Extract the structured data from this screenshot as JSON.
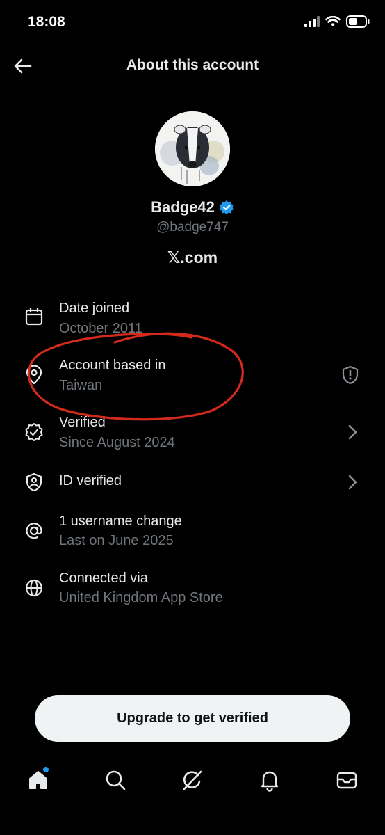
{
  "status_bar": {
    "time": "18:08"
  },
  "header": {
    "title": "About this account",
    "back_icon": "back-arrow-icon"
  },
  "profile": {
    "display_name": "Badge42",
    "handle": "@badge747",
    "platform": "𝕏.com",
    "verified_color": "#1d9bf0"
  },
  "info": [
    {
      "icon": "calendar-icon",
      "title": "Date joined",
      "subtitle": "October 2011"
    },
    {
      "icon": "location-pin-icon",
      "title": "Account based in",
      "subtitle": "Taiwan",
      "trailing_icon": "shield-alert-icon"
    },
    {
      "icon": "verified-badge-icon",
      "title": "Verified",
      "subtitle": "Since August 2024",
      "trailing_icon": "chevron-right-icon"
    },
    {
      "icon": "id-shield-icon",
      "title": "ID verified",
      "subtitle": "",
      "trailing_icon": "chevron-right-icon"
    },
    {
      "icon": "at-sign-icon",
      "title": "1 username change",
      "subtitle": "Last on June 2025"
    },
    {
      "icon": "globe-icon",
      "title": "Connected via",
      "subtitle": "United Kingdom App Store"
    }
  ],
  "cta": {
    "label": "Upgrade to get verified"
  },
  "tabs": [
    "home-icon",
    "search-icon",
    "grok-icon",
    "notifications-icon",
    "messages-icon"
  ],
  "colors": {
    "background": "#000000",
    "text": "#e7e9ea",
    "muted": "#71767b",
    "accent": "#1d9bf0",
    "annotation": "#d42a1c"
  }
}
